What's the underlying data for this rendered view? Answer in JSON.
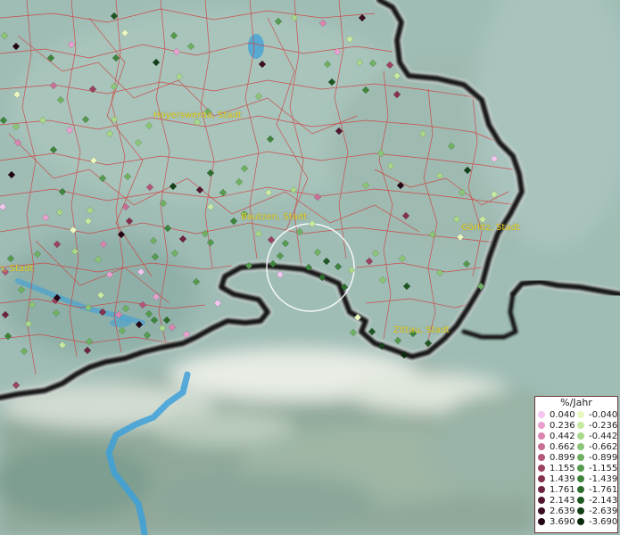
{
  "places": [
    {
      "name": "Hoyerswerda, Stadt"
    },
    {
      "name": "Bautzen, Stadt"
    },
    {
      "name": "Görlitz, Stadt"
    },
    {
      "name": "Zittau, Stadt"
    },
    {
      "name": "n, Stadt"
    }
  ],
  "legend": {
    "title": "%/Jahr",
    "positive": [
      {
        "label": "0.040",
        "color": "#f4c6ef"
      },
      {
        "label": "0.236",
        "color": "#e9a0cf"
      },
      {
        "label": "0.442",
        "color": "#d985b0"
      },
      {
        "label": "0.662",
        "color": "#c76f95"
      },
      {
        "label": "0.899",
        "color": "#b2577a"
      },
      {
        "label": "1.155",
        "color": "#9b4262"
      },
      {
        "label": "1.439",
        "color": "#84304e"
      },
      {
        "label": "1.761",
        "color": "#6c2240"
      },
      {
        "label": "2.143",
        "color": "#531631"
      },
      {
        "label": "2.639",
        "color": "#3b0d22"
      },
      {
        "label": "3.690",
        "color": "#240515"
      }
    ],
    "negative": [
      {
        "label": "-0.040",
        "color": "#eaf7c0"
      },
      {
        "label": "-0.236",
        "color": "#c8eaa0"
      },
      {
        "label": "-0.442",
        "color": "#a9d88a"
      },
      {
        "label": "-0.662",
        "color": "#8cc577"
      },
      {
        "label": "-0.899",
        "color": "#6fb063"
      },
      {
        "label": "-1.155",
        "color": "#559a4f"
      },
      {
        "label": "-1.439",
        "color": "#3f843d"
      },
      {
        "label": "-1.761",
        "color": "#2d6d2e"
      },
      {
        "label": "-2.143",
        "color": "#1f5722"
      },
      {
        "label": "-2.639",
        "color": "#134018"
      },
      {
        "label": "-3.690",
        "color": "#0a2a0e"
      }
    ]
  },
  "colors": {
    "border": "#1a1a1a",
    "admin_lines": "#d23a3a",
    "water": "#3da0d8",
    "place_label": "#e8d020"
  }
}
